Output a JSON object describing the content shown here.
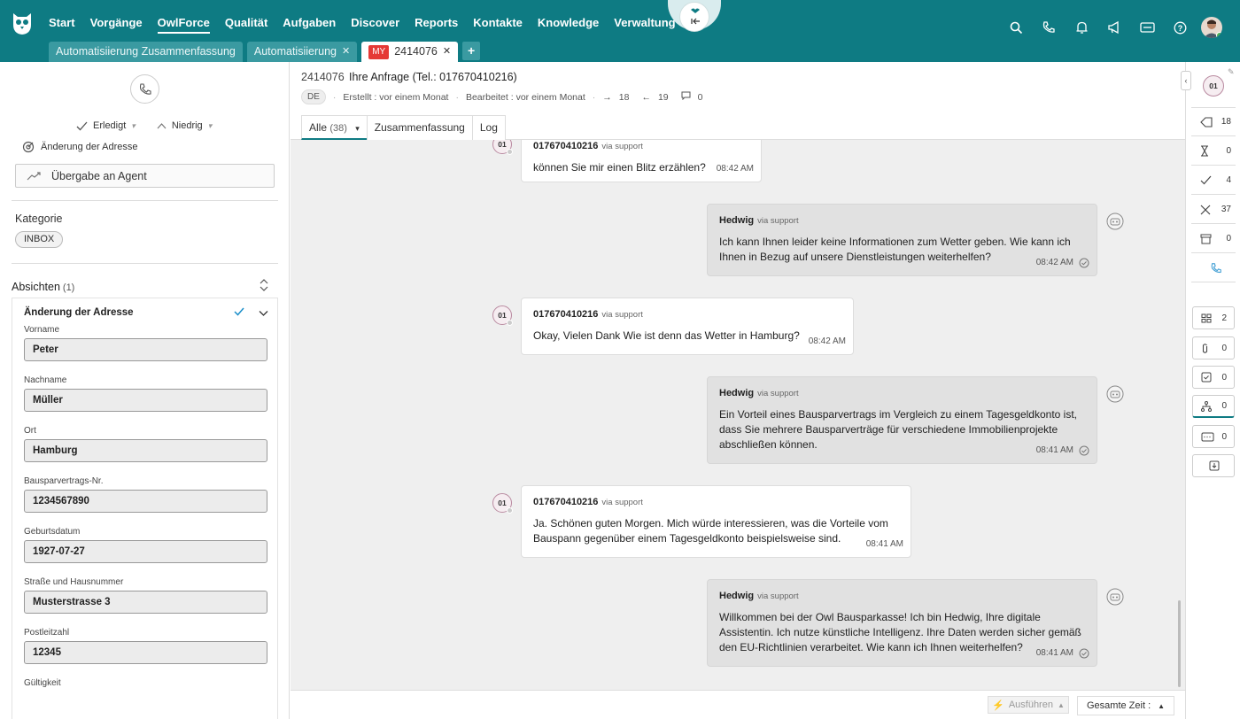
{
  "nav": {
    "items": [
      "Start",
      "Vorgänge",
      "OwlForce",
      "Qualität",
      "Aufgaben",
      "Discover",
      "Reports",
      "Kontakte",
      "Knowledge",
      "Verwaltung"
    ],
    "active": "OwlForce"
  },
  "subtabs": {
    "tab1": "Automatisiierung Zusammenfassung",
    "tab2": "Automatisiierung",
    "tab3_badge": "MY",
    "tab3": "2414076",
    "plus": "+"
  },
  "left": {
    "status": "Erledigt",
    "priority": "Niedrig",
    "adr_change": "Änderung der Adresse",
    "agent_button": "Übergabe an Agent",
    "category_title": "Kategorie",
    "category_chip": "INBOX",
    "intents_title": "Absichten",
    "intents_count": "(1)",
    "intent_name": "Änderung der Adresse",
    "fields": [
      {
        "label": "Vorname",
        "value": "Peter"
      },
      {
        "label": "Nachname",
        "value": "Müller"
      },
      {
        "label": "Ort",
        "value": "Hamburg"
      },
      {
        "label": "Bausparvertrags-Nr.",
        "value": "1234567890"
      },
      {
        "label": "Geburtsdatum",
        "value": "1927-07-27"
      },
      {
        "label": "Straße und Hausnummer",
        "value": "Musterstrasse 3"
      },
      {
        "label": "Postleitzahl",
        "value": "12345"
      },
      {
        "label": "Gültigkeit",
        "value": ""
      }
    ]
  },
  "ticket": {
    "id": "2414076",
    "title": "Ihre Anfrage (Tel.: 017670410216)",
    "lang": "DE",
    "created": "Erstellt : vor einem Monat",
    "edited": "Bearbeitet : vor einem Monat",
    "out_count": "18",
    "in_count": "19",
    "comment_count": "0",
    "tabs": {
      "all": "Alle",
      "all_count": "(38)",
      "summary": "Zusammenfassung",
      "log": "Log"
    }
  },
  "messages": [
    {
      "sender": "017670410216",
      "via": "via support",
      "text": "können Sie mir einen Blitz erzählen?",
      "time": "08:42 AM"
    },
    {
      "sender": "Hedwig",
      "via": "via support",
      "line1": "Ich kann Ihnen leider keine Informationen zum Wetter geben. Wie kann ich",
      "line2": "Ihnen in Bezug auf unsere Dienstleistungen weiterhelfen?",
      "time": "08:42 AM"
    },
    {
      "sender": "017670410216",
      "via": "via support",
      "text": "Okay, Vielen Dank Wie ist denn das Wetter in Hamburg?",
      "time": "08:42 AM"
    },
    {
      "sender": "Hedwig",
      "via": "via support",
      "line1": "Ein Vorteil eines Bausparvertrags im Vergleich zu einem Tagesgeldkonto ist,",
      "line2": "dass Sie mehrere Bausparverträge für verschiedene Immobilienprojekte",
      "line3": "abschließen können.",
      "time": "08:41 AM"
    },
    {
      "sender": "017670410216",
      "via": "via support",
      "line1": "Ja. Schönen guten Morgen. Mich würde interessieren, was die Vorteile vom",
      "line2": "Bauspann gegenüber einem Tagesgeldkonto beispielsweise sind.",
      "time": "08:41 AM"
    },
    {
      "sender": "Hedwig",
      "via": "via support",
      "line1": "Willkommen bei der Owl Bausparkasse! Ich bin Hedwig, Ihre digitale",
      "line2": "Assistentin. Ich nutze künstliche Intelligenz. Ihre Daten werden sicher gemäß",
      "line3": "den EU-Richtlinien verarbeitet. Wie kann ich Ihnen weiterhelfen?",
      "time": "08:41 AM"
    }
  ],
  "avatar_label": "01",
  "bottom": {
    "run": "Ausführen",
    "time": "Gesamte Zeit :"
  },
  "rail": {
    "avatar": "01",
    "rows": [
      "18",
      "0",
      "4",
      "37",
      "0"
    ],
    "boxes": [
      "2",
      "0",
      "0",
      "0",
      "0"
    ]
  },
  "colors": {
    "brand": "#0e7b83",
    "tab": "#3a9aa1",
    "badge": "#e53935"
  }
}
